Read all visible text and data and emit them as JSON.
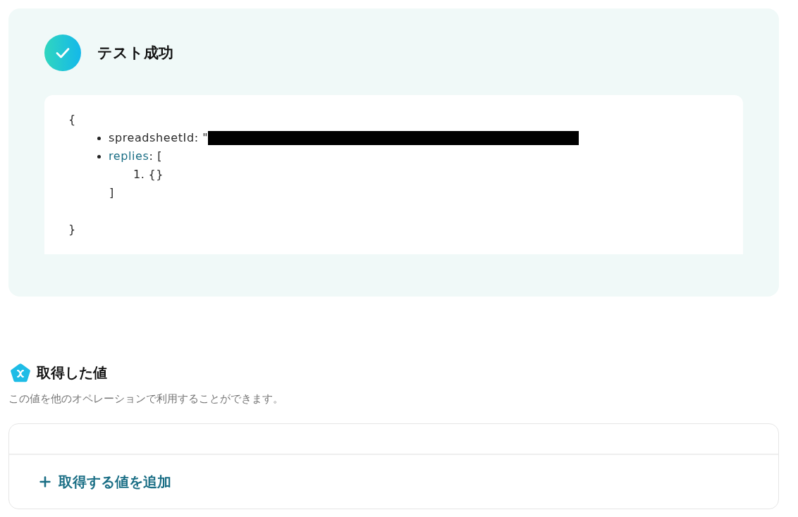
{
  "test_result": {
    "passed": true,
    "title": "テスト成功",
    "output": {
      "open": "{",
      "fields": [
        {
          "kind": "value",
          "key": "spreadsheetId",
          "text": ": \"",
          "expandable": false,
          "redacted": true
        },
        {
          "kind": "array",
          "key": "replies",
          "text": ": [",
          "expandable": true,
          "redacted": false,
          "items": [
            {
              "number": "1.",
              "text": "{}"
            }
          ],
          "close": "]"
        }
      ],
      "close": "}"
    }
  },
  "values_section": {
    "title": "取得した値",
    "description": "この値を他のオペレーションで利用することができます。",
    "add_button": "取得する値を追加"
  }
}
